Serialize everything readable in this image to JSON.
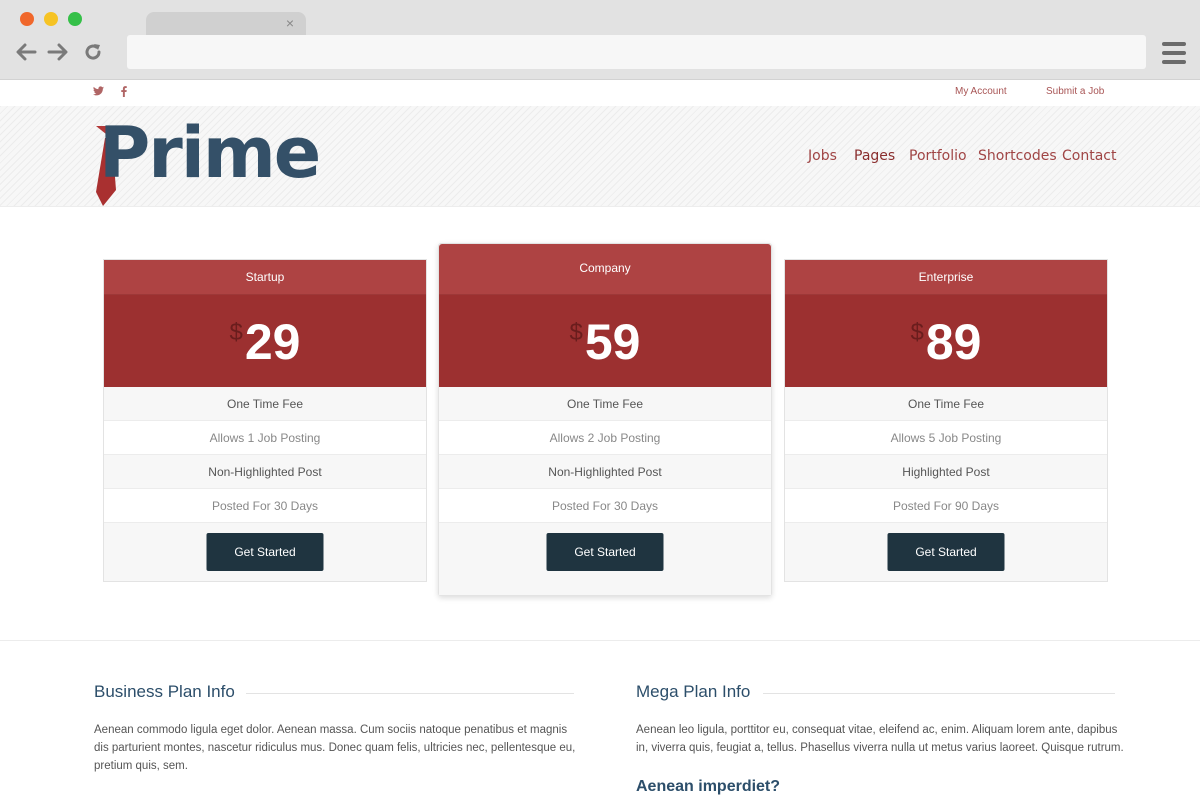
{
  "browser": {
    "tab_close": "×"
  },
  "topbar": {
    "social": [
      "twitter-icon",
      "facebook-icon"
    ],
    "links": [
      "My Account",
      "Submit a Job"
    ]
  },
  "header": {
    "logo_text": "Prime",
    "nav": [
      "Jobs",
      "Pages",
      "Portfolio",
      "Shortcodes",
      "Contact"
    ]
  },
  "pricing": {
    "currency": "$",
    "plans": [
      {
        "name": "Startup",
        "price": "29",
        "features": [
          "One Time Fee",
          "Allows 1 Job Posting",
          "Non-Highlighted Post",
          "Posted For 30 Days"
        ],
        "button": "Get Started"
      },
      {
        "name": "Company",
        "price": "59",
        "features": [
          "One Time Fee",
          "Allows 2 Job Posting",
          "Non-Highlighted Post",
          "Posted For 30 Days"
        ],
        "button": "Get Started"
      },
      {
        "name": "Enterprise",
        "price": "89",
        "features": [
          "One Time Fee",
          "Allows 5 Job Posting",
          "Highlighted Post",
          "Posted For 90 Days"
        ],
        "button": "Get Started"
      }
    ]
  },
  "info": {
    "left": {
      "title": "Business Plan Info",
      "text": "Aenean commodo ligula eget dolor. Aenean massa. Cum sociis natoque penatibus et magnis dis parturient montes, nascetur ridiculus mus. Donec quam felis, ultricies nec, pellentesque eu, pretium quis, sem."
    },
    "right": {
      "title": "Mega Plan Info",
      "text": "Aenean leo ligula, porttitor eu, consequat vitae, eleifend ac, enim. Aliquam lorem ante, dapibus in, viverra quis, feugiat a, tellus. Phasellus viverra nulla ut metus varius laoreet. Quisque rutrum.",
      "subtitle": "Aenean imperdiet?"
    }
  },
  "colors": {
    "accent": "#ae4343",
    "price_bg": "#9c3030",
    "button": "#1f3440",
    "logo": "#345068"
  }
}
